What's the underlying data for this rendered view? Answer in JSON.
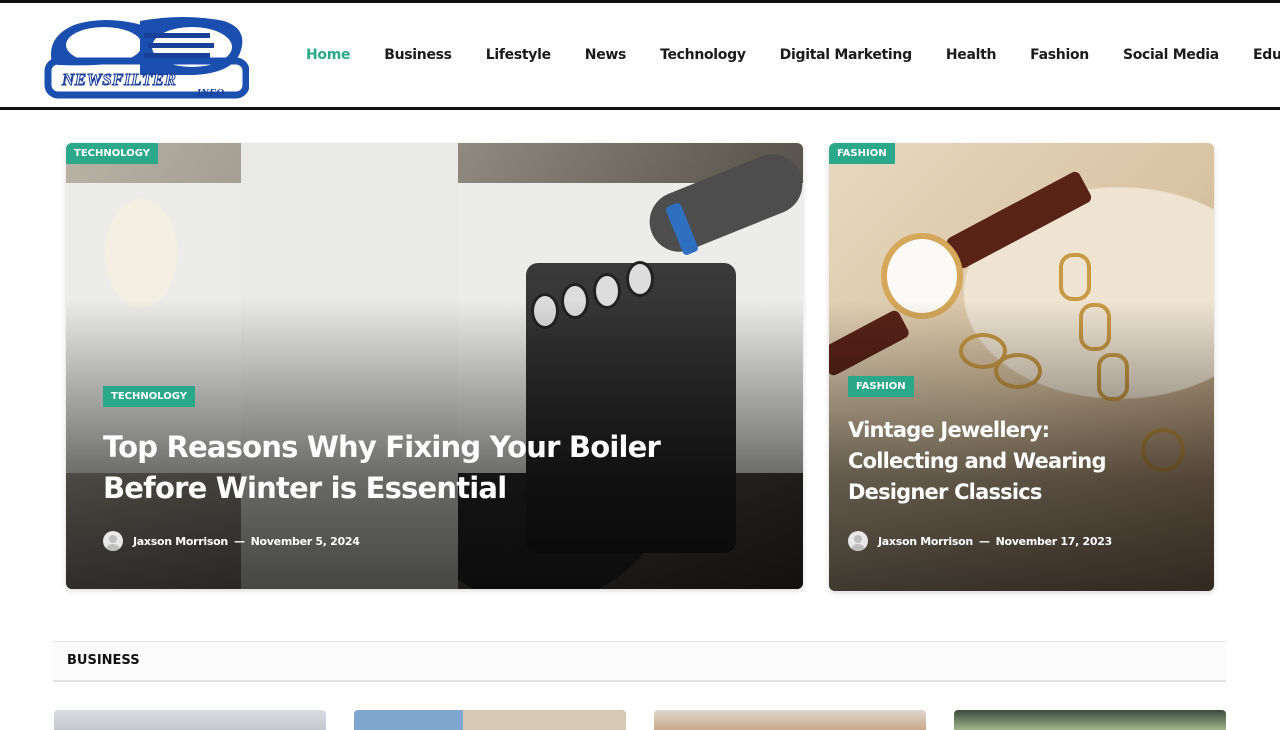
{
  "header": {
    "logo_text": "NEWSFILTER",
    "logo_sub": ".INFO",
    "nav": [
      {
        "label": "Home",
        "active": true
      },
      {
        "label": "Business"
      },
      {
        "label": "Lifestyle"
      },
      {
        "label": "News"
      },
      {
        "label": "Technology"
      },
      {
        "label": "Digital Marketing"
      },
      {
        "label": "Health"
      },
      {
        "label": "Fashion"
      },
      {
        "label": "Social Media"
      },
      {
        "label": "Education"
      }
    ]
  },
  "featured": [
    {
      "corner_tag": "TECHNOLOGY",
      "category": "TECHNOLOGY",
      "title_line1": "Top Reasons Why Fixing Your Boiler",
      "title_line2": "Before Winter is Essential",
      "author": "Jaxson Morrison",
      "date": "November 5, 2024"
    },
    {
      "corner_tag": "FASHION",
      "category": "FASHION",
      "title_line1": "Vintage Jewellery:",
      "title_line2": "Collecting and Wearing",
      "title_line3": "Designer Classics",
      "author": "Jaxson Morrison",
      "date": "November 17, 2023"
    }
  ],
  "section": {
    "title": "BUSINESS"
  },
  "colors": {
    "accent": "#2aa889",
    "text": "#1b1b1b",
    "rule": "#111111"
  }
}
